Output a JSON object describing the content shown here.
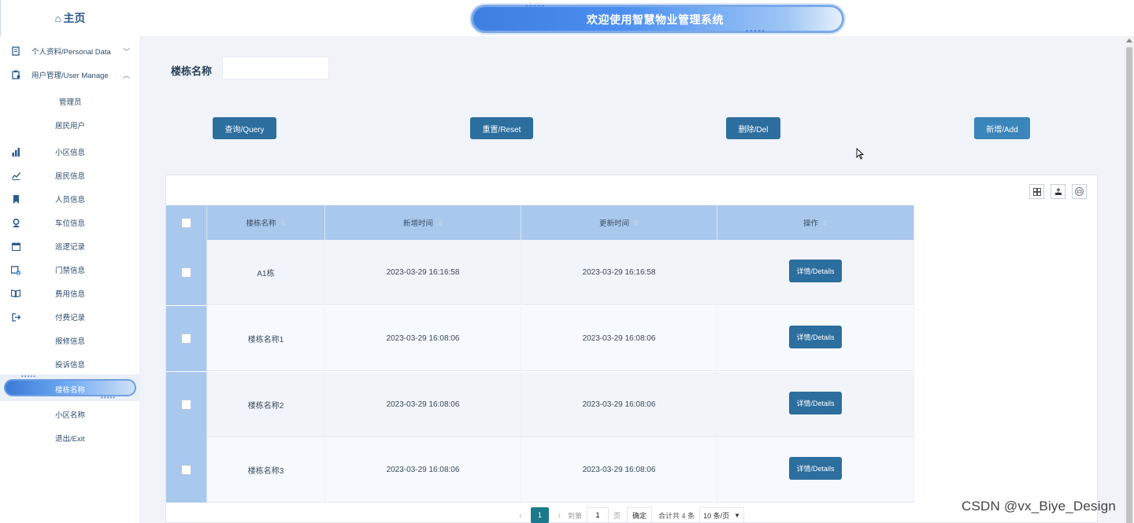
{
  "header": {
    "title": "欢迎使用智慧物业管理系统"
  },
  "sidebar": {
    "home": "主页",
    "items": [
      {
        "label": "个人资料/Personal Data",
        "icon": "document-icon"
      },
      {
        "label": "用户管理/User Manage",
        "icon": "clipboard-user-icon"
      },
      {
        "label": "管理员"
      },
      {
        "label": "居民用户"
      },
      {
        "label": "小区信息",
        "icon": "bar-chart-icon"
      },
      {
        "label": "居民信息",
        "icon": "line-chart-icon"
      },
      {
        "label": "人员信息",
        "icon": "bookmark-icon"
      },
      {
        "label": "车位信息",
        "icon": "person-pin-icon"
      },
      {
        "label": "巡逻记录",
        "icon": "calendar-icon"
      },
      {
        "label": "门禁信息",
        "icon": "calendar-check-icon"
      },
      {
        "label": "费用信息",
        "icon": "book-icon"
      },
      {
        "label": "付费记录",
        "icon": "logout-icon"
      },
      {
        "label": "报修信息"
      },
      {
        "label": "投诉信息"
      },
      {
        "label": "楼栋名称"
      },
      {
        "label": "小区名称"
      },
      {
        "label": "退出/Exit"
      }
    ]
  },
  "search": {
    "label": "楼栋名称",
    "value": "",
    "placeholder": ""
  },
  "buttons": {
    "query": "查询/Query",
    "reset": "重置/Reset",
    "delete": "删除/Del",
    "add": "新增/Add"
  },
  "table": {
    "columns": [
      "楼栋名称",
      "新增时间",
      "更新时间",
      "操作"
    ],
    "rows": [
      {
        "name": "A1栋",
        "created": "2023-03-29 16:16:58",
        "updated": "2023-03-29 16:16:58",
        "action": "详情/Details"
      },
      {
        "name": "楼栋名称1",
        "created": "2023-03-29 16:08:06",
        "updated": "2023-03-29 16:08:06",
        "action": "详情/Details"
      },
      {
        "name": "楼栋名称2",
        "created": "2023-03-29 16:08:06",
        "updated": "2023-03-29 16:08:06",
        "action": "详情/Details"
      },
      {
        "name": "楼栋名称3",
        "created": "2023-03-29 16:08:06",
        "updated": "2023-03-29 16:08:06",
        "action": "详情/Details"
      }
    ]
  },
  "pagination": {
    "current": "1",
    "goto_label": "到第",
    "goto_value": "1",
    "page_unit": "页",
    "confirm": "确定",
    "total": "合计共 4 条",
    "page_size": "10 条/页"
  },
  "watermark": "CSDN @vx_Biye_Design"
}
